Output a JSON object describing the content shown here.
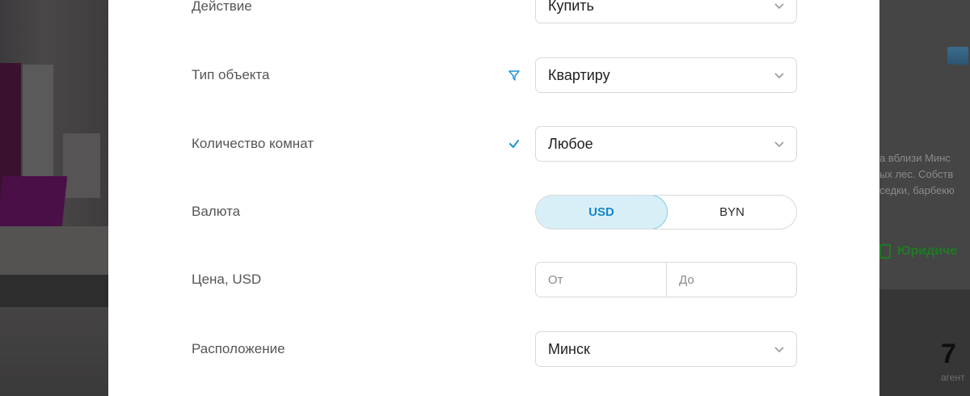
{
  "background": {
    "right_text_lines": [
      "а вблизи Минс",
      "ых лес. Собств",
      "седки, барбекю"
    ],
    "legal_label": "Юридиче",
    "count_value": "7",
    "count_label": "агент"
  },
  "form": {
    "action": {
      "label": "Действие",
      "value": "Купить"
    },
    "object_type": {
      "label": "Тип объекта",
      "value": "Квартиру",
      "indicator": "filter-icon"
    },
    "rooms": {
      "label": "Количество комнат",
      "value": "Любое",
      "indicator": "check-icon"
    },
    "currency": {
      "label": "Валюта",
      "options": [
        "USD",
        "BYN"
      ],
      "selected": "USD"
    },
    "price": {
      "label": "Цена, USD",
      "from_placeholder": "От",
      "to_placeholder": "До"
    },
    "location": {
      "label": "Расположение",
      "value": "Минск"
    }
  },
  "colors": {
    "accent": "#1a93d6",
    "toggle_active_bg": "#d9eff8",
    "legal_green": "#1f7a24"
  }
}
